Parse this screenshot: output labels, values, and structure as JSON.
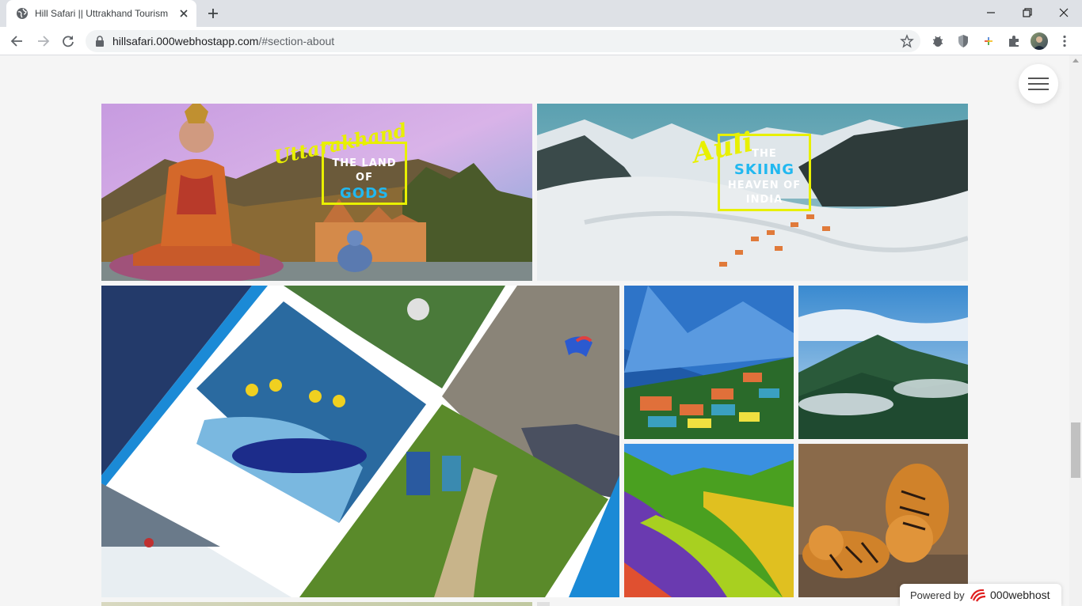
{
  "browser": {
    "tab_title": "Hill Safari || Uttrakhand Tourism",
    "url_host": "hillsafari.000webhostapp.com",
    "url_path": "/#section-about"
  },
  "gallery": {
    "tiles": [
      {
        "id": "uttarakhand",
        "script": "Uttarakhand",
        "line1": "THE LAND",
        "line2": "OF",
        "line3": "GODS"
      },
      {
        "id": "auli",
        "script": "Auli",
        "line1": "THE",
        "line2": "SKIING",
        "line3": "HEAVEN OF",
        "line4": "INDIA"
      },
      {
        "id": "adventure-collage"
      },
      {
        "id": "hill-town"
      },
      {
        "id": "misty-mountains"
      },
      {
        "id": "valley-of-flowers"
      },
      {
        "id": "tigers"
      }
    ]
  },
  "footer": {
    "powered_label": "Powered by",
    "powered_brand": "000webhost"
  },
  "colors": {
    "caption_yellow": "#e8f000",
    "caption_blue": "#21b8f0",
    "accent_blue": "#1b8ad6"
  },
  "icons": [
    "globe-icon",
    "close-icon",
    "plus-icon",
    "back-icon",
    "forward-icon",
    "reload-icon",
    "lock-icon",
    "star-icon",
    "bug-icon",
    "shield-icon",
    "sparkle-icon",
    "puzzle-icon",
    "kebab-menu-icon",
    "hamburger-icon"
  ]
}
